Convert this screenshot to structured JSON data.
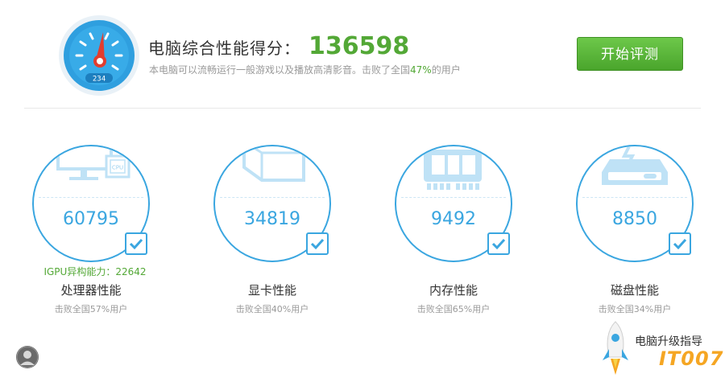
{
  "summary": {
    "score_label": "电脑综合性能得分：",
    "score_value": "136598",
    "gauge_readout": "234",
    "desc_prefix": "本电脑可以流畅运行一般游戏以及播放高清影音。击败了全国",
    "desc_percent": "47%",
    "desc_suffix": "的用户",
    "start_button": "开始评测"
  },
  "cards": [
    {
      "icon": "computer-cpu-icon",
      "score": "60795",
      "extra": "IGPU异构能力：22642",
      "label": "处理器性能",
      "beat": "击败全国57%用户",
      "chip_text": "CPU"
    },
    {
      "icon": "graphics-card-icon",
      "score": "34819",
      "label": "显卡性能",
      "beat": "击败全国40%用户"
    },
    {
      "icon": "memory-icon",
      "score": "9492",
      "label": "内存性能",
      "beat": "击败全国65%用户"
    },
    {
      "icon": "disk-icon",
      "score": "8850",
      "label": "磁盘性能",
      "beat": "击败全国34%用户"
    }
  ],
  "footer": {
    "upgrade_guide": "电脑升级指导",
    "watermark": "IT007"
  },
  "colors": {
    "accent_blue": "#3aa6e0",
    "accent_green": "#53a836",
    "button_green": "#5bb83a",
    "muted_text": "#9a9a9a"
  }
}
